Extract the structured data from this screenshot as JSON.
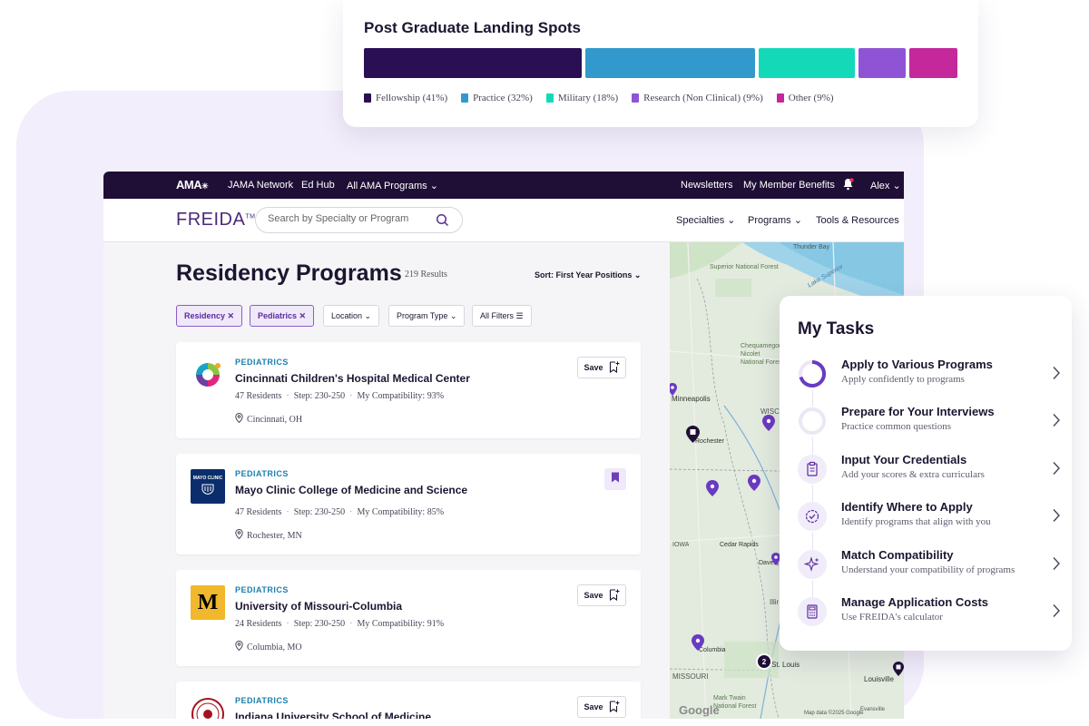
{
  "chart": {
    "title": "Post Graduate Landing Spots"
  },
  "chart_data": {
    "type": "bar",
    "title": "Post Graduate Landing Spots",
    "orientation": "horizontal-stacked",
    "series": [
      {
        "name": "Fellowship (41%)",
        "value": 41,
        "color": "#2a0f55"
      },
      {
        "name": "Practice (32%)",
        "value": 32,
        "color": "#3399cc"
      },
      {
        "name": "Military (18%)",
        "value": 18,
        "color": "#14d9b9"
      },
      {
        "name": "Research (Non Clinical) (9%)",
        "value": 9,
        "color": "#8f54d6"
      },
      {
        "name": "Other (9%)",
        "value": 9,
        "color": "#c4289a"
      }
    ],
    "legend": "bottom"
  },
  "topbar": {
    "logo": "AMA",
    "links": [
      "JAMA Network",
      "Ed Hub",
      "All AMA Programs"
    ],
    "right": [
      "Newsletters",
      "My Member Benefits"
    ],
    "user": "Alex"
  },
  "navbar": {
    "logo": "FREIDA",
    "tm": "TM",
    "search_placeholder": "Search by Specialty or Program",
    "menus": [
      "Specialties",
      "Programs",
      "Tools & Resources"
    ]
  },
  "main": {
    "title": "Residency Programs",
    "results": "219 Results",
    "sort": "Sort: First Year Positions",
    "filters": {
      "active": [
        "Residency",
        "Pediatrics"
      ],
      "dropdowns": [
        "Location",
        "Program Type"
      ],
      "all_filters": "All Filters"
    },
    "save_label": "Save",
    "programs": [
      {
        "specialty": "PEDIATRICS",
        "name": "Cincinnati Children's Hospital Medical Center",
        "residents": "47 Residents",
        "step": "Step: 230-250",
        "compat": "My Compatibility: 93%",
        "location": "Cincinnati, OH",
        "saved": false
      },
      {
        "specialty": "PEDIATRICS",
        "name": "Mayo Clinic College of Medicine and Science",
        "residents": "47 Residents",
        "step": "Step: 230-250",
        "compat": "My Compatibility: 85%",
        "location": "Rochester, MN",
        "saved": true,
        "logo_text": "MAYO CLINIC"
      },
      {
        "specialty": "PEDIATRICS",
        "name": "University of Missouri-Columbia",
        "residents": "24 Residents",
        "step": "Step: 230-250",
        "compat": "My Compatibility: 91%",
        "location": "Columbia, MO",
        "saved": false,
        "logo_text": "M"
      },
      {
        "specialty": "PEDIATRICS",
        "name": "Indiana University School of Medicine",
        "saved": false
      }
    ]
  },
  "map": {
    "labels": [
      "Thunder Bay",
      "Superior National Forest",
      "Lake Superior",
      "Chequamegon-Nicolet National Forest",
      "Minneapolis",
      "Rochester",
      "WISC",
      "Cedar Rapids",
      "Davenport",
      "Illinois",
      "Columbia",
      "St. Louis",
      "MISSOURI",
      "Mark Twain National Forest",
      "Louisville",
      "Evansville",
      "IOWA",
      "Illinois",
      "Google"
    ],
    "cluster_count": "2",
    "attribution": "Map data ©2025 Google"
  },
  "tasks": {
    "title": "My Tasks",
    "items": [
      {
        "title": "Apply to Various Programs",
        "subtitle": "Apply confidently to programs",
        "icon": "progress-ring-icon"
      },
      {
        "title": "Prepare for Your Interviews",
        "subtitle": "Practice common questions",
        "icon": "empty-ring-icon"
      },
      {
        "title": "Input Your Credentials",
        "subtitle": "Add your scores & extra curriculars",
        "icon": "clipboard-icon"
      },
      {
        "title": "Identify Where to Apply",
        "subtitle": "Identify programs that align with you",
        "icon": "check-badge-icon"
      },
      {
        "title": "Match Compatibility",
        "subtitle": "Understand your compatibility of programs",
        "icon": "sparkle-icon"
      },
      {
        "title": "Manage Application Costs",
        "subtitle": "Use FREIDA's calculator",
        "icon": "calculator-icon"
      }
    ]
  },
  "colors": {
    "brand_dark": "#1f0f36",
    "brand_purple": "#5b2c9a",
    "specialty_blue": "#1b7fae",
    "backdrop": "#f2eefb"
  }
}
